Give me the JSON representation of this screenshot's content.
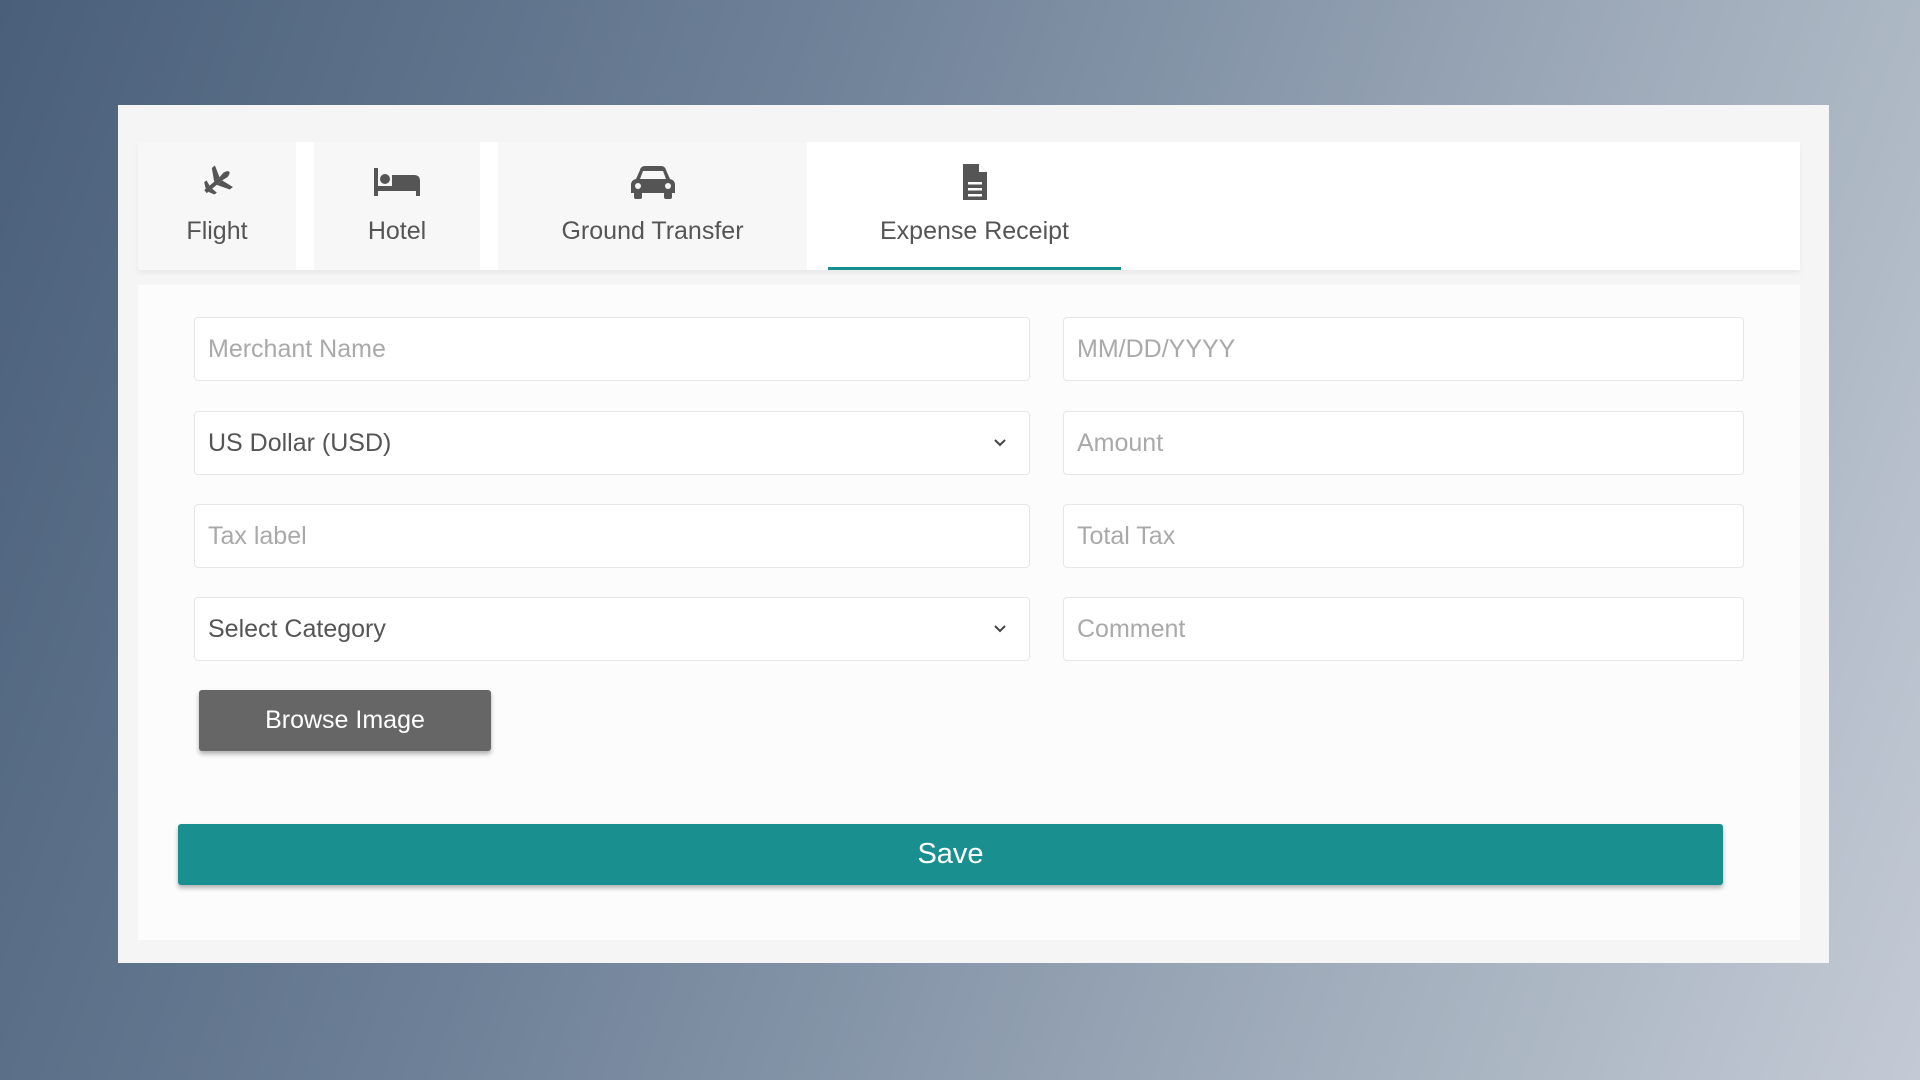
{
  "tabs": [
    {
      "label": "Flight",
      "icon": "plane-icon",
      "active": false
    },
    {
      "label": "Hotel",
      "icon": "bed-icon",
      "active": false
    },
    {
      "label": "Ground Transfer",
      "icon": "car-icon",
      "active": false
    },
    {
      "label": "Expense Receipt",
      "icon": "file-icon",
      "active": true
    }
  ],
  "form": {
    "merchant_name": {
      "placeholder": "Merchant Name",
      "value": ""
    },
    "date": {
      "placeholder": "MM/DD/YYYY",
      "value": ""
    },
    "currency": {
      "value": "US Dollar (USD)"
    },
    "amount": {
      "placeholder": "Amount",
      "value": ""
    },
    "tax_label": {
      "placeholder": "Tax label",
      "value": ""
    },
    "total_tax": {
      "placeholder": "Total Tax",
      "value": ""
    },
    "category": {
      "value": "Select Category"
    },
    "comment": {
      "placeholder": "Comment",
      "value": ""
    },
    "browse_label": "Browse Image",
    "save_label": "Save"
  },
  "colors": {
    "accent": "#1a8f8f",
    "browse_button": "#666666",
    "icon": "#555555"
  }
}
